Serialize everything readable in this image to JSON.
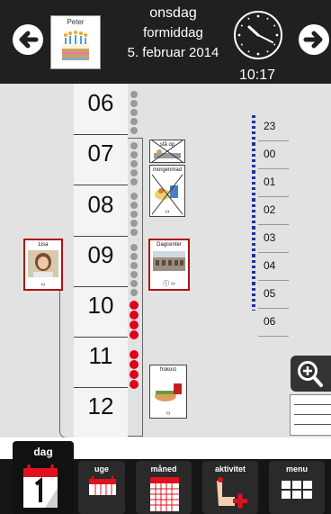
{
  "header": {
    "person": "Peter",
    "weekday": "onsdag",
    "daypart": "formiddag",
    "date": "5. februar 2014",
    "time": "10:17"
  },
  "schedule": {
    "hours": [
      "06",
      "07",
      "08",
      "09",
      "10",
      "11",
      "12"
    ],
    "activities": {
      "staa_op": {
        "label": "stå op"
      },
      "morgenmad": {
        "label": "morgenmad",
        "footer": "‹›"
      },
      "dagcenter": {
        "label": "Dagcenter",
        "footer": "ⓘ  ‹›"
      },
      "frokost": {
        "label": "frokost",
        "footer": "‹›"
      }
    },
    "person_card": {
      "label": "Lisa",
      "footer": "‹›"
    }
  },
  "mini_timeline": {
    "hours": [
      "23",
      "00",
      "01",
      "02",
      "03",
      "04",
      "05",
      "06"
    ]
  },
  "tabs": {
    "dag": "dag",
    "uge": "uge",
    "maaned": "måned",
    "aktivitet": "aktivitet",
    "menu": "menu"
  },
  "colors": {
    "accent_red": "#e0001a",
    "dots_blue": "#1f2fa6",
    "header_bg": "#202020"
  }
}
